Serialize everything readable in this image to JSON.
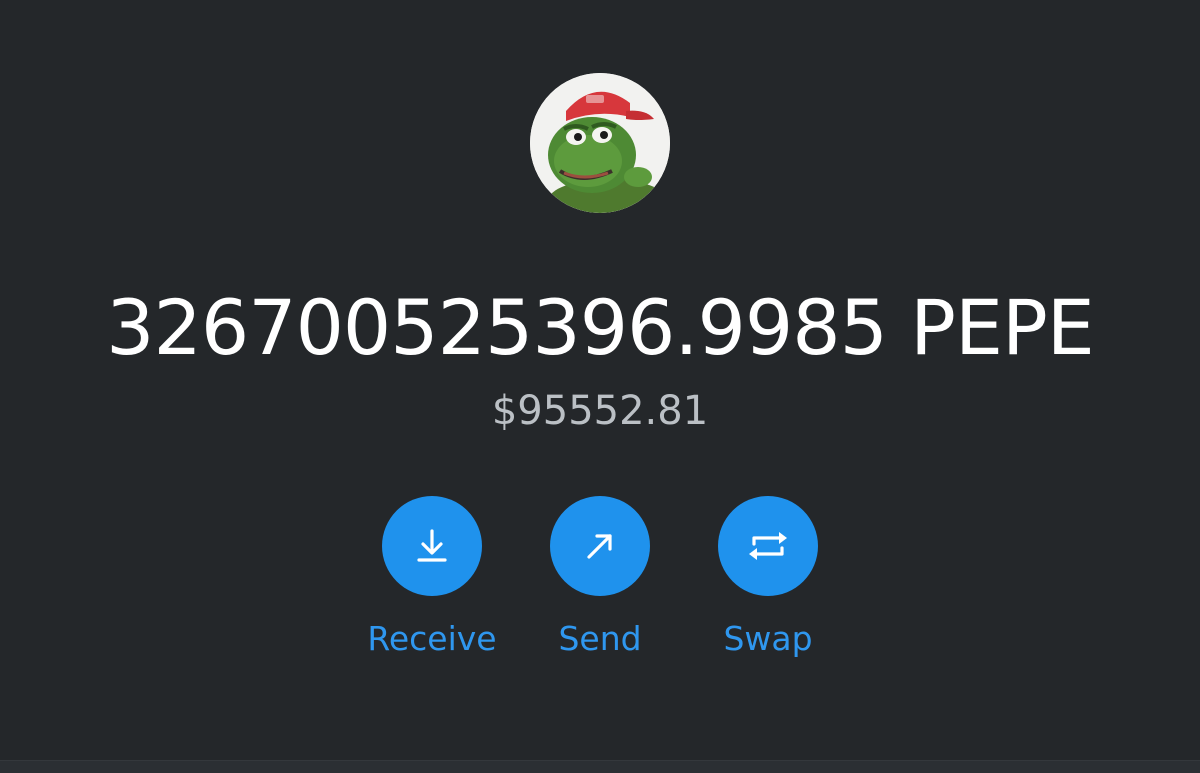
{
  "asset": {
    "balance": "326700525396.9985 PEPE",
    "fiat_value": "$95552.81",
    "icon": "pepe-frog-token-icon"
  },
  "actions": [
    {
      "label": "Receive",
      "icon": "download-arrow-icon"
    },
    {
      "label": "Send",
      "icon": "diagonal-arrow-icon"
    },
    {
      "label": "Swap",
      "icon": "swap-arrows-icon"
    }
  ],
  "colors": {
    "background": "#24272a",
    "accent": "#1f92ed",
    "text_primary": "#ffffff",
    "text_secondary": "#bbc0c5"
  }
}
